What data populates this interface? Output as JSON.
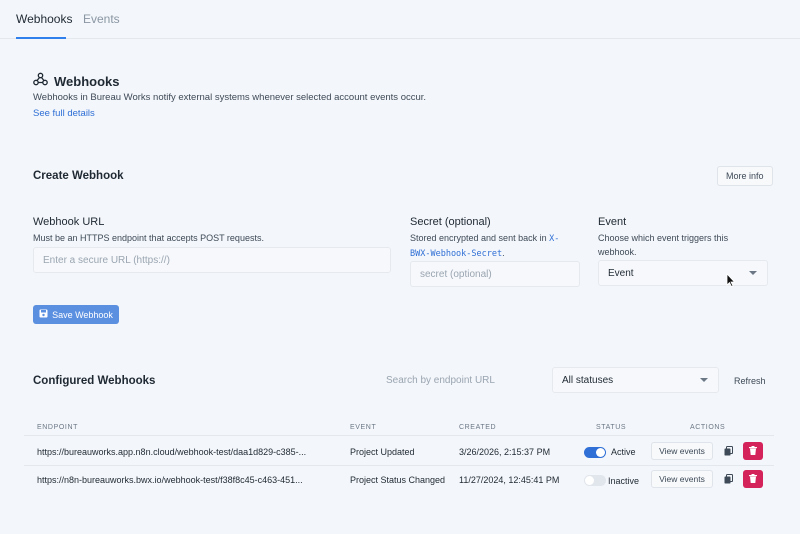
{
  "tabs": {
    "webhooks": "Webhooks",
    "events": "Events"
  },
  "intro": {
    "title": "Webhooks",
    "description": "Webhooks in Bureau Works notify external systems whenever selected account events occur.",
    "link": "See full details"
  },
  "create": {
    "title": "Create Webhook",
    "more_info": "More info",
    "url_label": "Webhook URL",
    "url_help": "Must be an HTTPS endpoint that accepts POST requests.",
    "url_placeholder": "Enter a secure URL (https://)",
    "secret_label": "Secret (optional)",
    "secret_help_1": "Stored encrypted and sent back in",
    "secret_help_code_1": "X-",
    "secret_help_code_2": "BWX-Webhook-Secret",
    "secret_help_end": ".",
    "secret_placeholder": "secret (optional)",
    "event_label": "Event",
    "event_help": "Choose which event triggers this webhook.",
    "event_selected": "Event",
    "save": "Save Webhook"
  },
  "configured": {
    "title": "Configured Webhooks",
    "search_placeholder": "Search by endpoint URL",
    "status_filter": "All statuses",
    "refresh": "Refresh",
    "columns": [
      "ENDPOINT",
      "EVENT",
      "CREATED",
      "STATUS",
      "ACTIONS"
    ],
    "rows": [
      {
        "endpoint": "https://bureauworks.app.n8n.cloud/webhook-test/daa1d829-c385-...",
        "event": "Project Updated",
        "created": "3/26/2026, 2:15:37 PM",
        "status": "Active",
        "active": true,
        "view": "View events"
      },
      {
        "endpoint": "https://n8n-bureauworks.bwx.io/webhook-test/f38f8c45-c463-451...",
        "event": "Project Status Changed",
        "created": "11/27/2024, 12:45:41 PM",
        "status": "Inactive",
        "active": false,
        "view": "View events"
      }
    ]
  },
  "colors": {
    "accent": "#2f80ed",
    "danger": "#d4225a",
    "button": "#5b8fe0"
  },
  "icons": [
    "webhook-icon",
    "save-icon",
    "chevron-down-icon",
    "copy-icon",
    "trash-icon",
    "mouse-cursor-icon"
  ]
}
